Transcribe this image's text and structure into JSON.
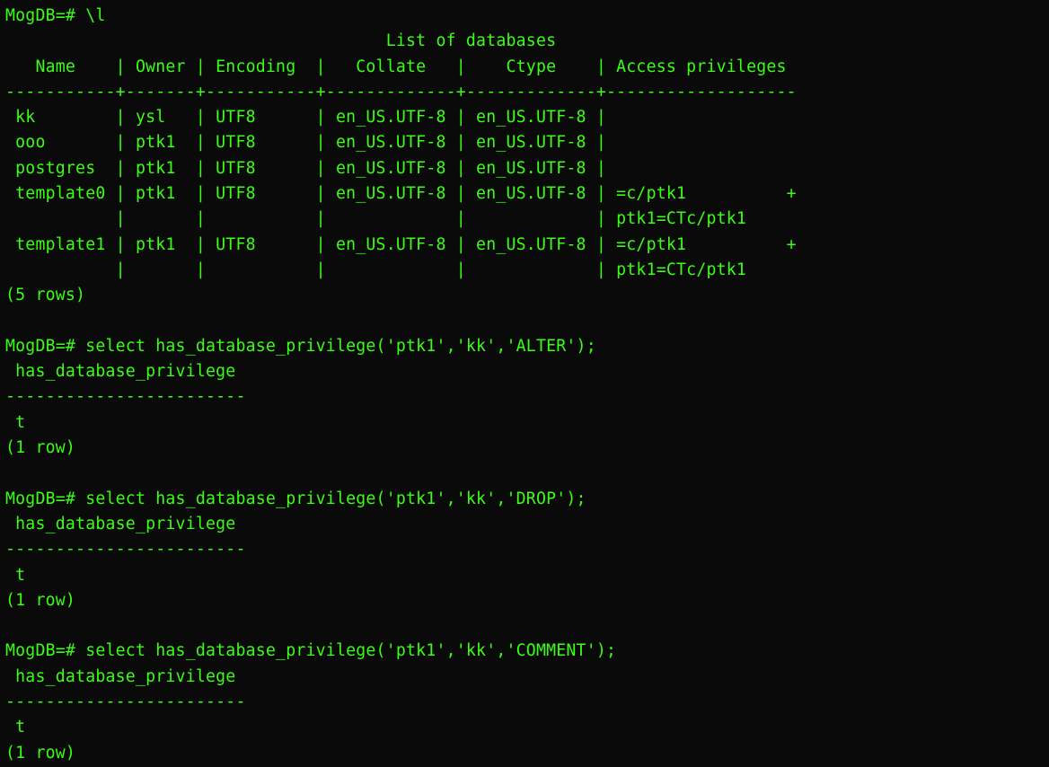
{
  "prompt": "MogDB=# ",
  "cmd1": "\\l",
  "list_title": "                                      List of databases",
  "header": "   Name    | Owner | Encoding  |   Collate   |    Ctype    | Access privileges ",
  "sep": "-----------+-------+-----------+-------------+-------------+-------------------",
  "rows": [
    " kk        | ysl   | UTF8      | en_US.UTF-8 | en_US.UTF-8 | ",
    " ooo       | ptk1  | UTF8      | en_US.UTF-8 | en_US.UTF-8 | ",
    " postgres  | ptk1  | UTF8      | en_US.UTF-8 | en_US.UTF-8 | ",
    " template0 | ptk1  | UTF8      | en_US.UTF-8 | en_US.UTF-8 | =c/ptk1          +",
    "           |       |           |             |             | ptk1=CTc/ptk1",
    " template1 | ptk1  | UTF8      | en_US.UTF-8 | en_US.UTF-8 | =c/ptk1          +",
    "           |       |           |             |             | ptk1=CTc/ptk1"
  ],
  "rowcount5": "(5 rows)",
  "blank": "",
  "query_alter": "select has_database_privilege('ptk1','kk','ALTER');",
  "query_drop": "select has_database_privilege('ptk1','kk','DROP');",
  "query_comment": "select has_database_privilege('ptk1','kk','COMMENT');",
  "result_header": " has_database_privilege ",
  "result_sep": "------------------------",
  "result_value": " t",
  "rowcount1": "(1 row)"
}
